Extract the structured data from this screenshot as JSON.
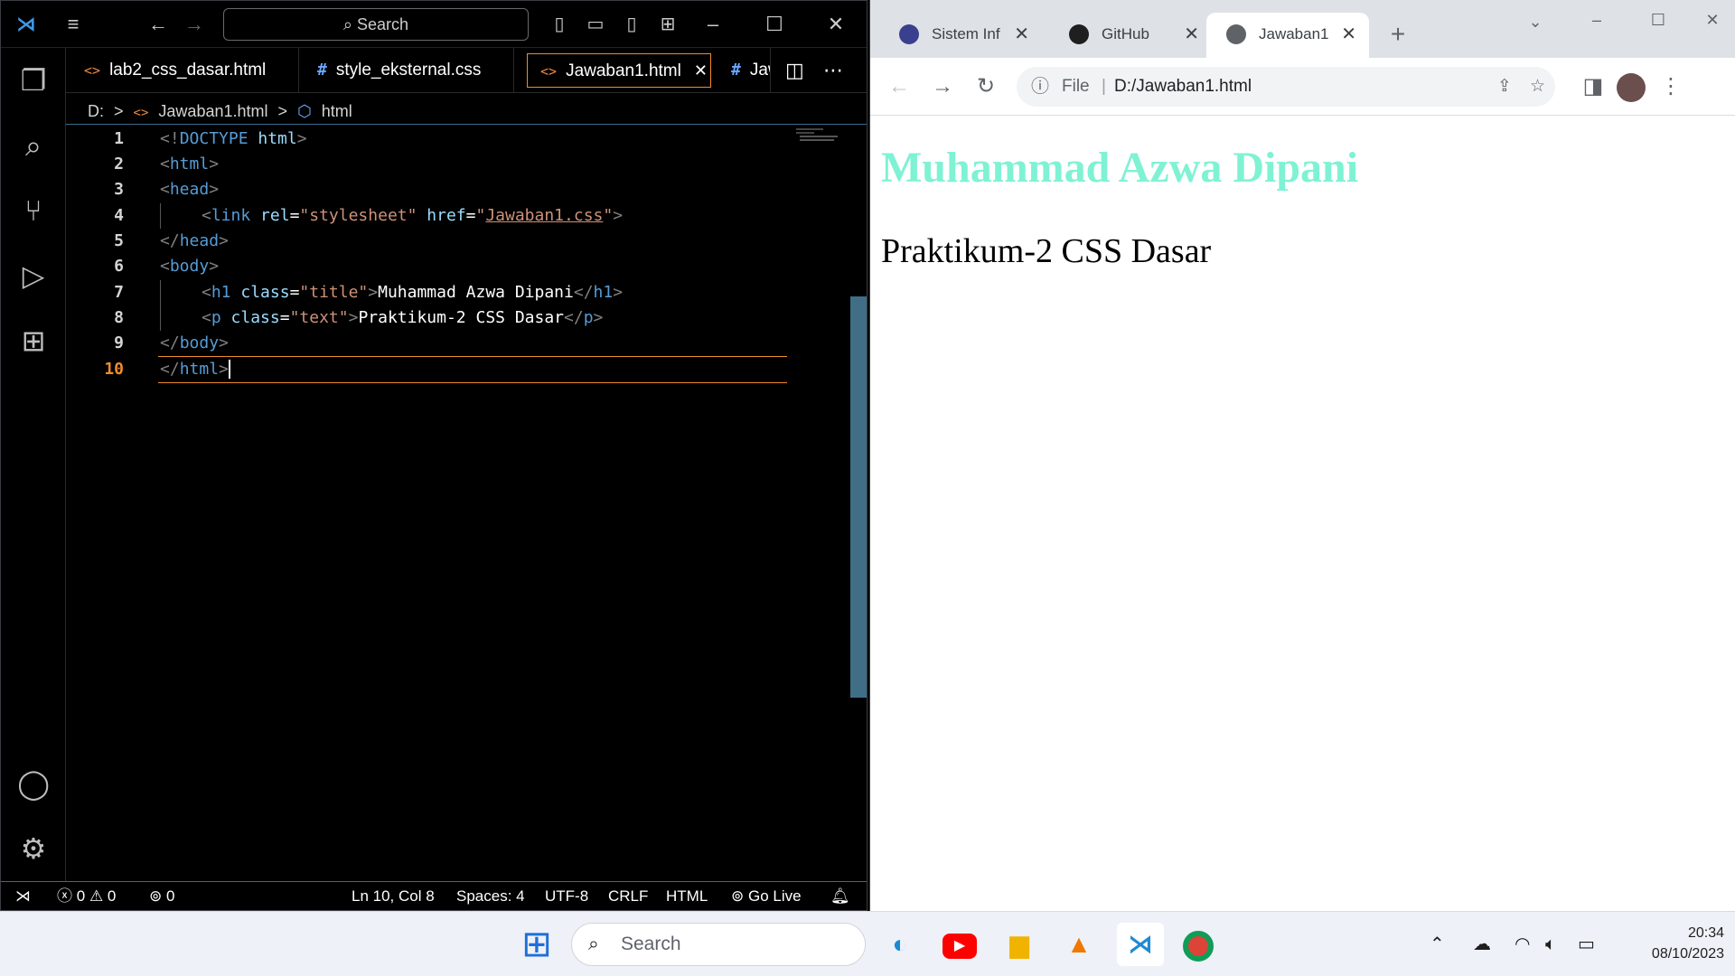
{
  "vscode": {
    "search_placeholder": "Search",
    "tabs": [
      {
        "icon": "<>",
        "label": "lab2_css_dasar.html"
      },
      {
        "icon": "#",
        "label": "style_eksternal.css"
      },
      {
        "icon": "<>",
        "label": "Jawaban1.html",
        "active": true
      },
      {
        "icon": "#",
        "label": "Jaw"
      }
    ],
    "breadcrumb": {
      "drive": "D:",
      "sep": ">",
      "file": "Jawaban1.html",
      "node": "html"
    },
    "line_numbers": [
      "1",
      "2",
      "3",
      "4",
      "5",
      "6",
      "7",
      "8",
      "9",
      "10"
    ],
    "code": {
      "l1": {
        "a": "<!",
        "b": "DOCTYPE",
        "c": " html",
        "d": ">"
      },
      "l2": {
        "a": "<",
        "b": "html",
        "c": ">"
      },
      "l3": {
        "a": "<",
        "b": "head",
        "c": ">"
      },
      "l4": {
        "a": "<",
        "b": "link",
        "c": " rel",
        "d": "=",
        "e": "\"stylesheet\"",
        "f": " href",
        "g": "=",
        "h": "\"",
        "i": "Jawaban1.css",
        "j": "\"",
        "k": ">"
      },
      "l5": {
        "a": "</",
        "b": "head",
        "c": ">"
      },
      "l6": {
        "a": "<",
        "b": "body",
        "c": ">"
      },
      "l7": {
        "a": "<",
        "b": "h1",
        "c": " class",
        "d": "=",
        "e": "\"title\"",
        "f": ">",
        "g": "Muhammad Azwa Dipani",
        "h": "</",
        "i": "h1",
        "j": ">"
      },
      "l8": {
        "a": "<",
        "b": "p",
        "c": " class",
        "d": "=",
        "e": "\"text\"",
        "f": ">",
        "g": "Praktikum-2 CSS Dasar",
        "h": "</",
        "i": "p",
        "j": ">"
      },
      "l9": {
        "a": "</",
        "b": "body",
        "c": ">"
      },
      "l10": {
        "a": "</",
        "b": "html",
        "c": ">"
      }
    },
    "status": {
      "errors": "0",
      "warnings": "0",
      "ports": "0",
      "position": "Ln 10, Col 8",
      "spaces": "Spaces: 4",
      "encoding": "UTF-8",
      "eol": "CRLF",
      "language": "HTML",
      "golive": "Go Live"
    }
  },
  "chrome": {
    "tabs": [
      {
        "label": "Sistem Inf"
      },
      {
        "label": "GitHub"
      },
      {
        "label": "Jawaban1",
        "active": true
      }
    ],
    "omnibox": {
      "scheme": "File",
      "url": "D:/Jawaban1.html"
    },
    "page": {
      "h1": "Muhammad Azwa Dipani",
      "p": "Praktikum-2 CSS Dasar"
    },
    "colors": {
      "h1": "#7ff2d4"
    }
  },
  "taskbar": {
    "search_label": "Search",
    "time": "20:34",
    "date": "08/10/2023"
  }
}
